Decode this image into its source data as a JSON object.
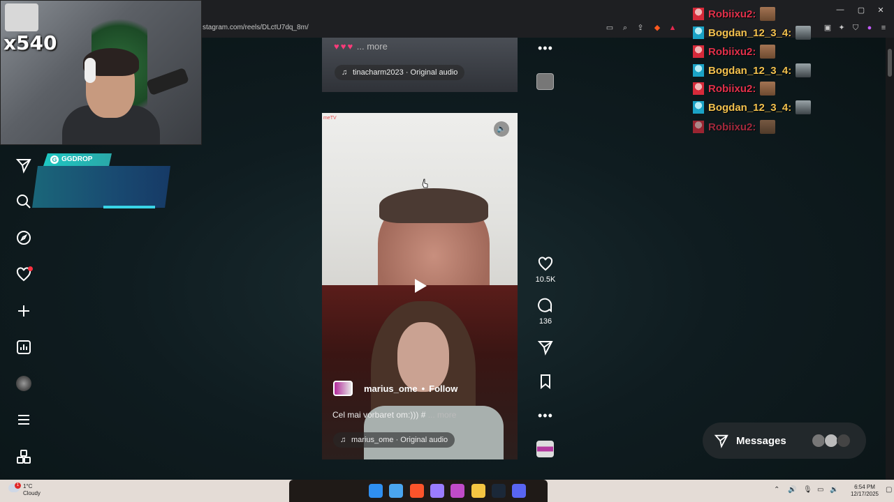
{
  "browser": {
    "url": "stagram.com/reels/DLctU7dq_8m/",
    "controls": {
      "minimize": "—",
      "maximize": "▢",
      "close": "✕"
    }
  },
  "overlay": {
    "viewer_count_label": "x540",
    "ggdrop_label": "GGDROP",
    "ggdrop_icon_letter": "G"
  },
  "reel_top": {
    "caption_hearts": "♥♥♥",
    "caption_more": "... more",
    "audio": "tinacharm2023 · Original audio"
  },
  "reel_main": {
    "watermark": "meTV",
    "author": "marius_ome",
    "separator": "•",
    "follow_label": "Follow",
    "caption": "Cel mai vorbaret om:))) #",
    "caption_more": "... more",
    "audio": "marius_ome · Original audio",
    "likes": "10.5K",
    "comments": "136"
  },
  "chat": [
    {
      "user": "Robiixu2:",
      "class": "robi"
    },
    {
      "user": "Bogdan_12_3_4:",
      "class": "bogdan"
    },
    {
      "user": "Robiixu2:",
      "class": "robi"
    },
    {
      "user": "Bogdan_12_3_4:",
      "class": "bogdan"
    },
    {
      "user": "Robiixu2:",
      "class": "robi"
    },
    {
      "user": "Bogdan_12_3_4:",
      "class": "bogdan"
    },
    {
      "user": "Robiixu2:",
      "class": "robi"
    }
  ],
  "messages": {
    "label": "Messages"
  },
  "taskbar": {
    "weather_temp": "1°C",
    "weather_desc": "Cloudy",
    "weather_badge": "1",
    "time": "6:54 PM",
    "date": "12/17/2025"
  },
  "colors": {
    "accent_like": "#ff3040",
    "chat_red": "#e1304a",
    "chat_gold": "#f2c14e",
    "ggdrop_teal": "#1ec7c2"
  }
}
